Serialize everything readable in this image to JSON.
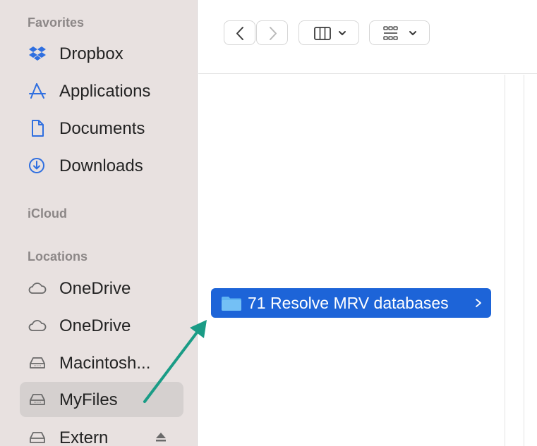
{
  "sidebar": {
    "favorites_header": "Favorites",
    "favorites": [
      {
        "label": "Dropbox",
        "icon": "dropbox-icon"
      },
      {
        "label": "Applications",
        "icon": "applications-icon"
      },
      {
        "label": "Documents",
        "icon": "document-icon"
      },
      {
        "label": "Downloads",
        "icon": "download-icon"
      }
    ],
    "icloud_header": "iCloud",
    "locations_header": "Locations",
    "locations": [
      {
        "label": "OneDrive",
        "icon": "cloud-icon"
      },
      {
        "label": "OneDrive",
        "icon": "cloud-icon"
      },
      {
        "label": "Macintosh...",
        "icon": "drive-icon"
      },
      {
        "label": "MyFiles",
        "icon": "drive-icon",
        "selected": true
      },
      {
        "label": "Extern",
        "icon": "drive-icon",
        "eject": true
      }
    ]
  },
  "toolbar": {
    "back": "back-chevron-icon",
    "forward": "forward-chevron-icon",
    "view_mode": "columns-view-icon",
    "group_mode": "icon-grid-icon"
  },
  "content": {
    "selected_folder": "71 Resolve MRV databases"
  },
  "colors": {
    "sidebar_bg": "#e8e1e0",
    "selection": "#1d64d8",
    "accent_icon": "#1a73e8",
    "annotation_arrow": "#1a9c86"
  }
}
